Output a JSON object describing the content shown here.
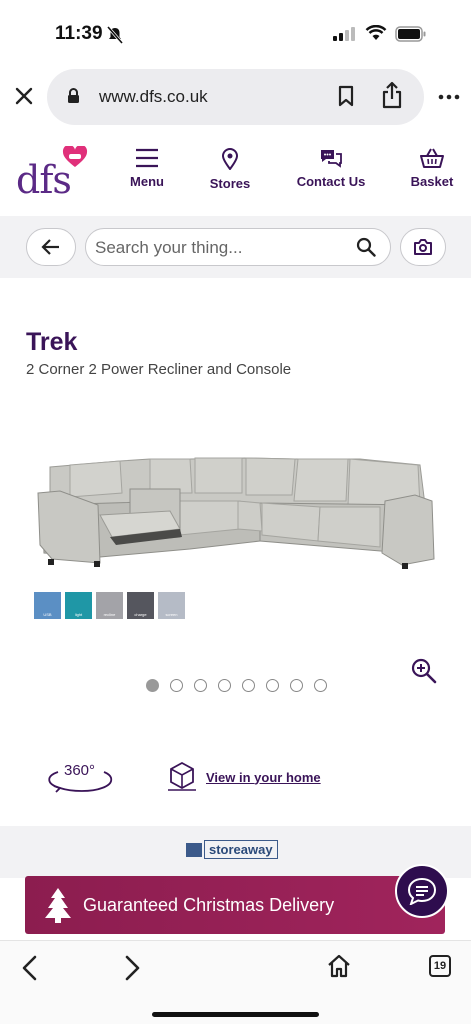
{
  "status": {
    "time": "11:39",
    "bell": "bell-slash-icon",
    "signal": "cell-signal-icon",
    "wifi": "wifi-icon",
    "battery": "battery-icon"
  },
  "browser": {
    "url": "www.dfs.co.uk",
    "tab_count": "19"
  },
  "header": {
    "logo_text": "dfs",
    "nav": [
      {
        "label": "Menu",
        "icon": "menu-icon"
      },
      {
        "label": "Stores",
        "icon": "location-pin-icon"
      },
      {
        "label": "Contact Us",
        "icon": "chat-bubbles-icon"
      },
      {
        "label": "Basket",
        "icon": "basket-icon"
      }
    ]
  },
  "search": {
    "placeholder": "Search your thing..."
  },
  "product": {
    "name": "Trek",
    "subtitle": "2 Corner 2 Power Recliner and Console",
    "features": [
      {
        "label": "USB",
        "color": "#5b8fc4"
      },
      {
        "label": "light",
        "color": "#1f97a6"
      },
      {
        "label": "recline",
        "color": "#a3a3a8"
      },
      {
        "label": "charge",
        "color": "#55565e"
      },
      {
        "label": "screen",
        "color": "#b5bbc6"
      }
    ],
    "gallery": {
      "total": 8,
      "active": 1
    }
  },
  "actions": {
    "spin_label": "360°",
    "view_home_label": "View in your home"
  },
  "storeaway": {
    "label": "storeaway"
  },
  "promo": {
    "label": "Guaranteed Christmas Delivery"
  },
  "colors": {
    "brand_purple": "#3a1458",
    "promo": "#9a2157"
  }
}
